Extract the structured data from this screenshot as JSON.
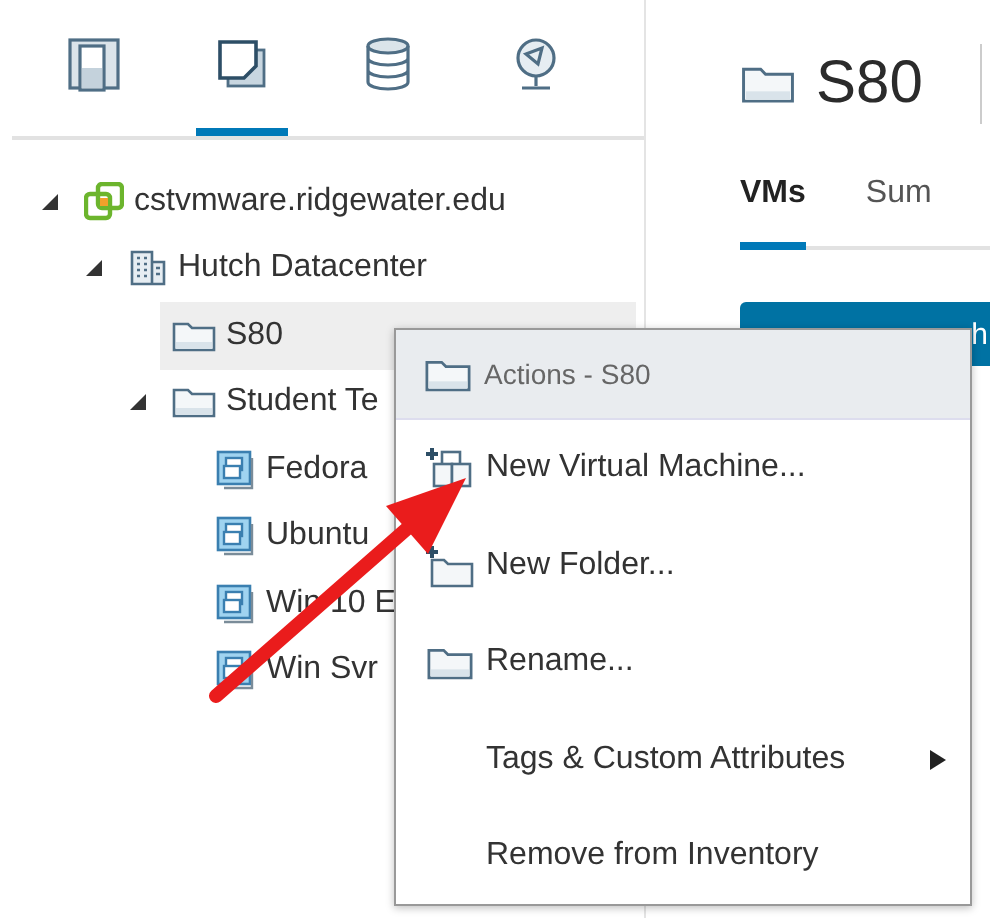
{
  "nav_tabs": [
    {
      "kind": "hosts",
      "selected": false
    },
    {
      "kind": "vms",
      "selected": true
    },
    {
      "kind": "storage",
      "selected": false
    },
    {
      "kind": "network",
      "selected": false
    }
  ],
  "tree": [
    {
      "label": "cstvmware.ridgewater.edu",
      "kind": "vcenter",
      "expanded": true,
      "selected": false,
      "children": [
        {
          "label": "Hutch Datacenter",
          "kind": "datacenter",
          "expanded": true,
          "selected": false,
          "children": [
            {
              "label": "S80",
              "kind": "folder",
              "expanded": false,
              "selected": true
            },
            {
              "label": "Student Te",
              "kind": "folder",
              "expanded": true,
              "selected": false,
              "children": [
                {
                  "label": "Fedora",
                  "kind": "vm",
                  "expanded": false,
                  "selected": false
                },
                {
                  "label": "Ubuntu",
                  "kind": "vm",
                  "expanded": false,
                  "selected": false
                },
                {
                  "label": "Win 10 E",
                  "kind": "vm",
                  "expanded": false,
                  "selected": false
                },
                {
                  "label": "Win Svr",
                  "kind": "vm",
                  "expanded": false,
                  "selected": false
                }
              ]
            }
          ]
        }
      ]
    }
  ],
  "header": {
    "title": "S80"
  },
  "tabs": [
    {
      "label": "VMs",
      "selected": true
    },
    {
      "label": "Sum",
      "selected": false
    }
  ],
  "action_button": {
    "label": "h"
  },
  "context_menu": {
    "title": "Actions - S80",
    "items": [
      {
        "label": "New Virtual Machine...",
        "kind": "new-vm",
        "submenu": false
      },
      {
        "label": "New Folder...",
        "kind": "new-folder",
        "submenu": false
      },
      {
        "label": "Rename...",
        "kind": "rename",
        "submenu": false
      },
      {
        "label": "Tags & Custom Attributes",
        "kind": "plain",
        "submenu": true
      },
      {
        "label": "Remove from Inventory",
        "kind": "plain",
        "submenu": false
      }
    ]
  }
}
